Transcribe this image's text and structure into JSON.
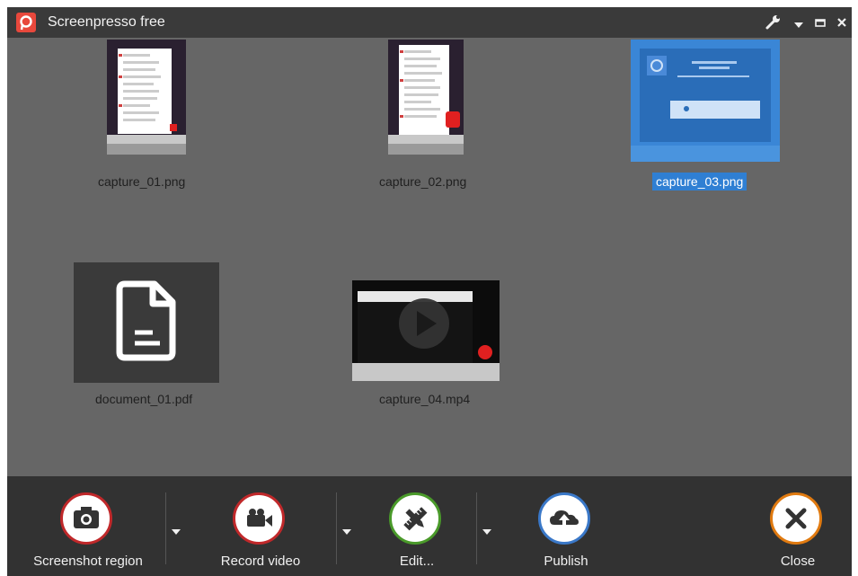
{
  "app": {
    "title": "Screenpresso free",
    "colors": {
      "brand": "#e8483c",
      "selection": "#2f7fd3",
      "window_bg": "#666666",
      "titlebar_bg": "#3a3a3a",
      "toolbar_bg": "#323232"
    }
  },
  "titlebar": {
    "icons": [
      "wrench-icon",
      "chevron-down-icon",
      "maximize-icon",
      "close-icon"
    ]
  },
  "gallery": {
    "items": [
      {
        "label": "capture_01.png",
        "type": "image",
        "selected": false
      },
      {
        "label": "capture_02.png",
        "type": "image",
        "selected": false
      },
      {
        "label": "capture_03.png",
        "type": "image",
        "selected": true
      },
      {
        "label": "document_01.pdf",
        "type": "document",
        "selected": false
      },
      {
        "label": "capture_04.mp4",
        "type": "video",
        "selected": false
      }
    ]
  },
  "toolbar": {
    "screenshot_label": "Screenshot region",
    "record_label": "Record video",
    "edit_label": "Edit...",
    "publish_label": "Publish",
    "close_label": "Close",
    "colors": {
      "screenshot": "#c0282a",
      "record": "#c0282a",
      "edit": "#4a9a2a",
      "publish": "#3a78c8",
      "close": "#e07a10"
    }
  }
}
